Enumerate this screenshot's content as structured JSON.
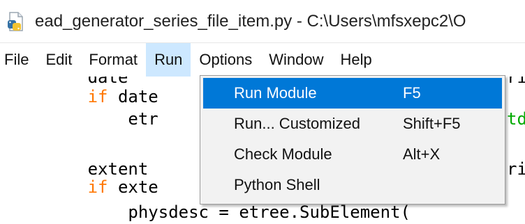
{
  "window": {
    "title": "ead_generator_series_file_item.py - C:\\Users\\mfsxepc2\\O",
    "icon": "python-file-icon"
  },
  "menubar": {
    "items": [
      {
        "label": "File"
      },
      {
        "label": "Edit"
      },
      {
        "label": "Format"
      },
      {
        "label": "Run",
        "open": true
      },
      {
        "label": "Options"
      },
      {
        "label": "Window"
      },
      {
        "label": "Help"
      }
    ]
  },
  "run_menu": {
    "items": [
      {
        "label": "Run Module",
        "shortcut": "F5",
        "selected": true
      },
      {
        "label": "Run... Customized",
        "shortcut": "Shift+F5"
      },
      {
        "label": "Check Module",
        "shortcut": "Alt+X"
      },
      {
        "label": "Python Shell",
        "shortcut": ""
      }
    ]
  },
  "editor": {
    "lines": [
      {
        "indent": "        ",
        "parts": [
          {
            "text": "date",
            "cls": ""
          }
        ]
      },
      {
        "indent": "        ",
        "parts": [
          {
            "text": "if",
            "cls": "kw"
          },
          {
            "text": " date",
            "cls": ""
          }
        ]
      },
      {
        "indent": "            ",
        "parts": [
          {
            "text": "etr",
            "cls": ""
          }
        ]
      },
      {
        "indent": "",
        "parts": [
          {
            "text": "",
            "cls": ""
          }
        ]
      },
      {
        "indent": "        ",
        "parts": [
          {
            "text": "extent",
            "cls": ""
          }
        ]
      },
      {
        "indent": "        ",
        "parts": [
          {
            "text": "if",
            "cls": "kw"
          },
          {
            "text": " exte",
            "cls": ""
          }
        ]
      },
      {
        "indent": "            ",
        "parts": [
          {
            "text": "physdesc = etree.SubElement(",
            "cls": ""
          }
        ]
      }
    ],
    "right_fragments": [
      {
        "text": "ri",
        "cls": ""
      },
      {
        "text": "td",
        "cls": "str"
      },
      {
        "text": "ri",
        "cls": ""
      }
    ]
  },
  "colors": {
    "menu_highlight": "#0078d7",
    "open_menu_bg": "#cde8ff",
    "keyword": "#ff7700",
    "string": "#00aa00"
  }
}
